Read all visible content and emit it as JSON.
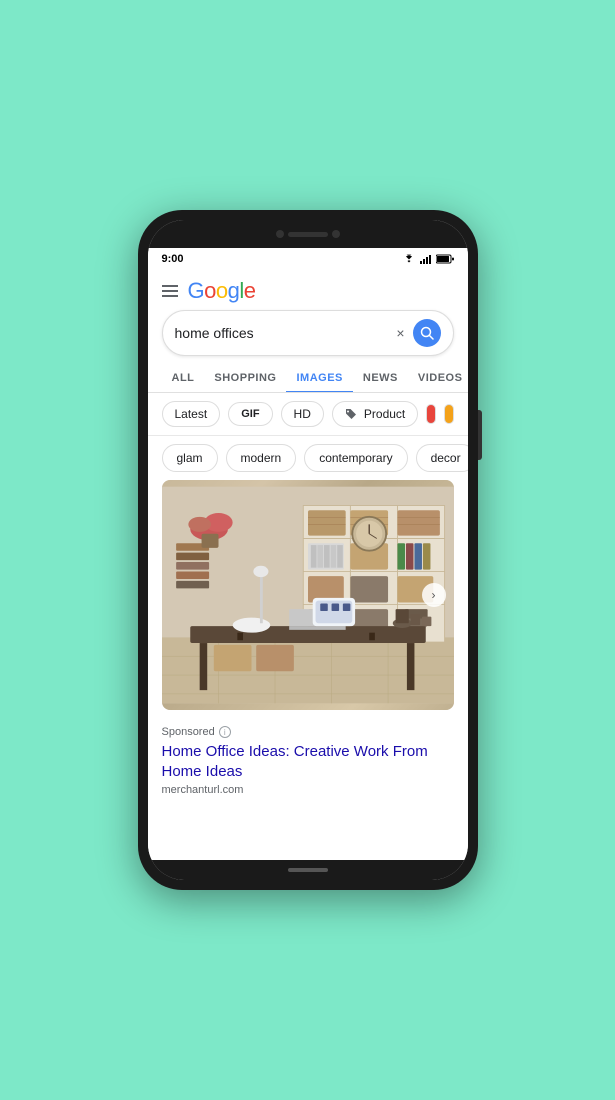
{
  "phone": {
    "status_time": "9:00",
    "background_color": "#7de8c8"
  },
  "header": {
    "menu_label": "menu",
    "google_logo": "Google"
  },
  "search": {
    "query": "home offices",
    "clear_label": "×",
    "search_label": "🔍"
  },
  "nav_tabs": [
    {
      "id": "all",
      "label": "ALL",
      "active": false
    },
    {
      "id": "shopping",
      "label": "SHOPPING",
      "active": false
    },
    {
      "id": "images",
      "label": "IMAGES",
      "active": true
    },
    {
      "id": "news",
      "label": "NEWS",
      "active": false
    },
    {
      "id": "videos",
      "label": "VIDEOS",
      "active": false
    }
  ],
  "filters": {
    "latest_label": "Latest",
    "gif_label": "GIF",
    "hd_label": "HD",
    "product_label": "Product",
    "color1": "#E8453C",
    "color2": "#F4A21A"
  },
  "style_chips": [
    {
      "label": "glam"
    },
    {
      "label": "modern"
    },
    {
      "label": "contemporary"
    },
    {
      "label": "decor"
    }
  ],
  "image_result": {
    "nav_arrow": "›"
  },
  "sponsored": {
    "label": "Sponsored",
    "info_symbol": "i",
    "title": "Home Office Ideas: Creative Work From Home Ideas",
    "url": "merchanturl.com"
  }
}
